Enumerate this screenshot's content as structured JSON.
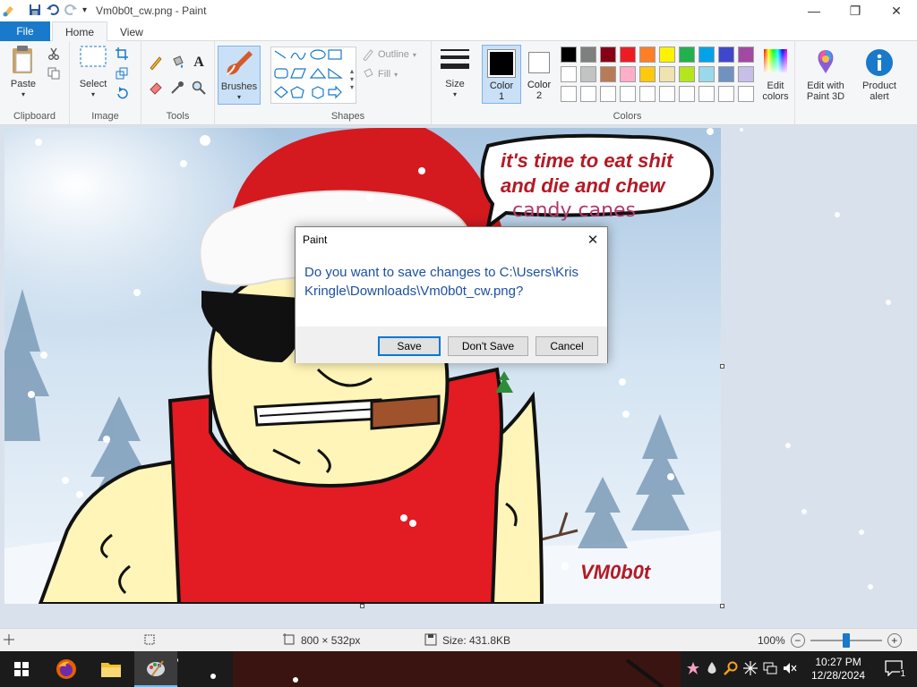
{
  "window": {
    "title": "Vm0b0t_cw.png - Paint",
    "minimize": "—",
    "maximize": "❐",
    "close": "✕"
  },
  "tabs": {
    "file": "File",
    "home": "Home",
    "view": "View"
  },
  "ribbon": {
    "clipboard": {
      "label": "Clipboard",
      "paste": "Paste"
    },
    "image": {
      "label": "Image",
      "select": "Select"
    },
    "tools": {
      "label": "Tools"
    },
    "brushes": {
      "label": "Brushes"
    },
    "shapes": {
      "label": "Shapes",
      "outline": "Outline",
      "fill": "Fill"
    },
    "size": {
      "label": "Size"
    },
    "color1": {
      "label1": "Color",
      "label2": "1",
      "value": "#000000"
    },
    "color2": {
      "label1": "Color",
      "label2": "2",
      "value": "#ffffff"
    },
    "colors": {
      "label": "Colors"
    },
    "edit_colors": {
      "label1": "Edit",
      "label2": "colors"
    },
    "paint3d": {
      "label1": "Edit with",
      "label2": "Paint 3D"
    },
    "product_alert": {
      "label1": "Product",
      "label2": "alert"
    }
  },
  "palette": {
    "row1": [
      "#000000",
      "#7f7f7f",
      "#880015",
      "#ed1c24",
      "#ff7f27",
      "#fff200",
      "#22b14c",
      "#00a2e8",
      "#3f48cc",
      "#a349a4"
    ],
    "row2": [
      "#ffffff",
      "#c3c3c3",
      "#b97a57",
      "#ffaec9",
      "#ffc90e",
      "#efe4b0",
      "#b5e61d",
      "#99d9ea",
      "#7092be",
      "#c8bfe7"
    ],
    "row3": [
      "#ffffff",
      "#ffffff",
      "#ffffff",
      "#ffffff",
      "#ffffff",
      "#ffffff",
      "#ffffff",
      "#ffffff",
      "#ffffff",
      "#ffffff"
    ]
  },
  "image_content": {
    "speech_line1": "it's time to eat shit",
    "speech_line2": "and die and chew",
    "speech_line3": "candy canes",
    "signature": "VM0b0t"
  },
  "dialog": {
    "title": "Paint",
    "message": "Do you want to save changes to C:\\Users\\Kris Kringle\\Downloads\\Vm0b0t_cw.png?",
    "save": "Save",
    "dont_save": "Don't Save",
    "cancel": "Cancel"
  },
  "status": {
    "dimensions": "800 × 532px",
    "size": "Size: 431.8KB",
    "zoom": "100%",
    "zoom_level": 1.0
  },
  "taskbar": {
    "time": "10:27 PM",
    "date": "12/28/2024",
    "notifications": "1"
  },
  "colors": {
    "accent": "#1979ca",
    "red": "#e31b23",
    "skin": "#fff5b8"
  }
}
